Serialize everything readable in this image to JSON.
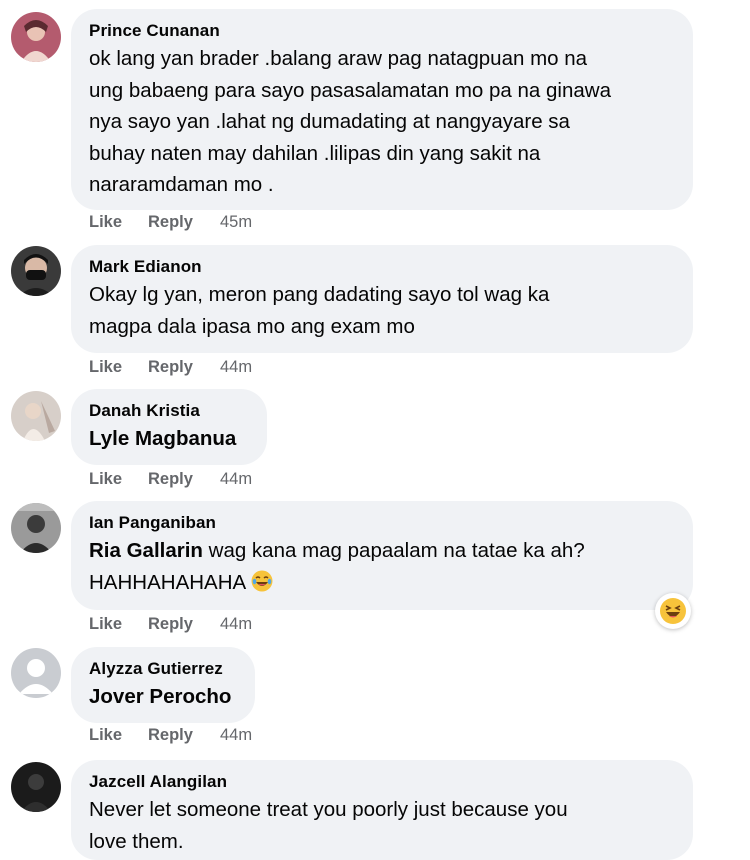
{
  "comments": [
    {
      "author": "Prince Cunanan",
      "text": "ok lang yan brader .balang araw pag natagpuan mo na\nung babaeng para sayo pasasalamatan mo pa na ginawa\nnya sayo yan .lahat ng dumadating at nangyayare sa\nbuhay naten may dahilan .lilipas din yang sakit na\nnararamdaman mo .",
      "like": "Like",
      "reply": "Reply",
      "time": "45m"
    },
    {
      "author": "Mark Edianon",
      "text": "Okay lg yan, meron pang dadating sayo tol wag ka\nmagpa dala ipasa mo ang exam mo",
      "like": "Like",
      "reply": "Reply",
      "time": "44m"
    },
    {
      "author": "Danah Kristia",
      "mention": "Lyle Magbanua",
      "like": "Like",
      "reply": "Reply",
      "time": "44m"
    },
    {
      "author": "Ian Panganiban",
      "mention": "Ria Gallarin",
      "text_after_mention": " wag kana mag papaalam na tatae ka ah?",
      "text_line2": "HAHHAHAHAHA",
      "like": "Like",
      "reply": "Reply",
      "time": "44m"
    },
    {
      "author": "Alyzza Gutierrez",
      "mention": "Jover Perocho",
      "like": "Like",
      "reply": "Reply",
      "time": "44m"
    },
    {
      "author": "Jazcell Alangilan",
      "text": "Never let someone treat you poorly just because you\nlove them."
    }
  ],
  "icons": {
    "inline_emoji": "laughing-tears-emoji-icon",
    "reaction": "haha-reaction-icon"
  },
  "colors": {
    "bubble_bg": "#f0f2f5",
    "meta_text": "#65676b",
    "emoji_yellow": "#f7c33b"
  }
}
